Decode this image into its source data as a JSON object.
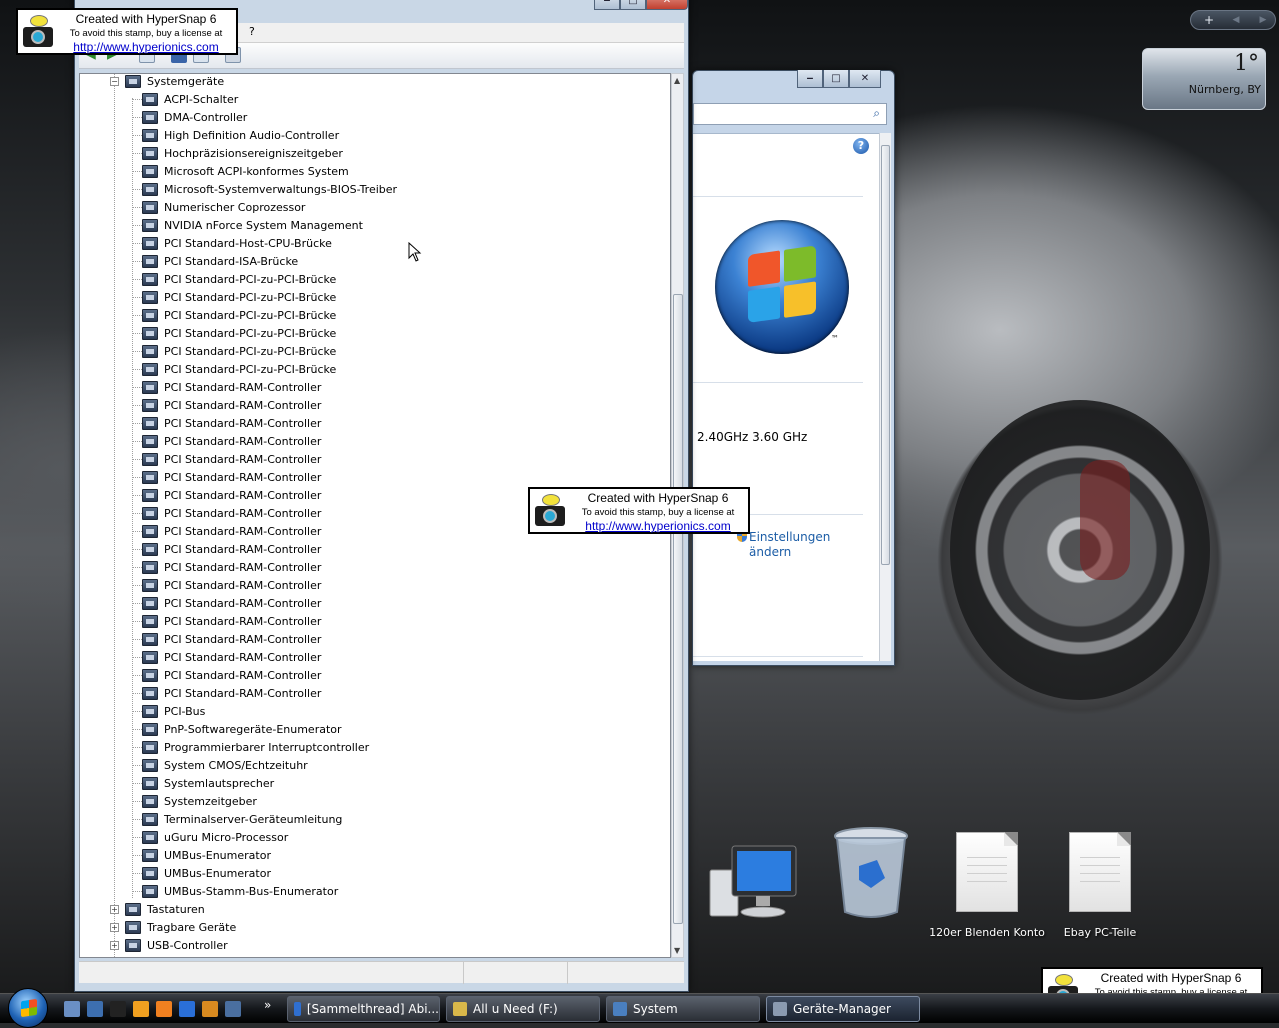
{
  "device_manager": {
    "title": "Geräte-Manager",
    "menu_partial": "?",
    "tree": {
      "category": "Systemgeräte",
      "children": [
        "ACPI-Schalter",
        "DMA-Controller",
        "High Definition Audio-Controller",
        "Hochpräzisionsereigniszeitgeber",
        "Microsoft ACPI-konformes System",
        "Microsoft-Systemverwaltungs-BIOS-Treiber",
        "Numerischer Coprozessor",
        "NVIDIA nForce System Management",
        "PCI Standard-Host-CPU-Brücke",
        "PCI Standard-ISA-Brücke",
        "PCI Standard-PCI-zu-PCI-Brücke",
        "PCI Standard-PCI-zu-PCI-Brücke",
        "PCI Standard-PCI-zu-PCI-Brücke",
        "PCI Standard-PCI-zu-PCI-Brücke",
        "PCI Standard-PCI-zu-PCI-Brücke",
        "PCI Standard-PCI-zu-PCI-Brücke",
        "PCI Standard-RAM-Controller",
        "PCI Standard-RAM-Controller",
        "PCI Standard-RAM-Controller",
        "PCI Standard-RAM-Controller",
        "PCI Standard-RAM-Controller",
        "PCI Standard-RAM-Controller",
        "PCI Standard-RAM-Controller",
        "PCI Standard-RAM-Controller",
        "PCI Standard-RAM-Controller",
        "PCI Standard-RAM-Controller",
        "PCI Standard-RAM-Controller",
        "PCI Standard-RAM-Controller",
        "PCI Standard-RAM-Controller",
        "PCI Standard-RAM-Controller",
        "PCI Standard-RAM-Controller",
        "PCI Standard-RAM-Controller",
        "PCI Standard-RAM-Controller",
        "PCI Standard-RAM-Controller",
        "PCI-Bus",
        "PnP-Softwaregeräte-Enumerator",
        "Programmierbarer Interruptcontroller",
        "System CMOS/Echtzeituhr",
        "Systemlautsprecher",
        "Systemzeitgeber",
        "Terminalserver-Geräteumleitung",
        "uGuru Micro-Processor",
        "UMBus-Enumerator",
        "UMBus-Enumerator",
        "UMBus-Stamm-Bus-Enumerator"
      ],
      "siblings_after": [
        "Tastaturen",
        "Tragbare Geräte",
        "USB-Controller"
      ],
      "collapsed_symbol": "−",
      "expand_symbol": "+"
    }
  },
  "system_window": {
    "help_symbol": "?",
    "search_icon": "search-icon",
    "cpu_text": "2.40GHz   3.60 GHz",
    "settings_link": [
      "Einstellungen",
      "ändern"
    ],
    "logo_tm": "™"
  },
  "weather_gadget": {
    "temperature": "1°",
    "city": "Nürnberg, BY"
  },
  "sidebar_controls": {
    "add": "+",
    "prev": "◀",
    "next": "▶"
  },
  "desktop_icons": [
    {
      "name": "computer-icon",
      "label": ""
    },
    {
      "name": "recycle-bin-icon",
      "label": ""
    },
    {
      "name": "document-icon",
      "label": "120er Blenden Konto"
    },
    {
      "name": "document-icon",
      "label": "Ebay PC-Teile"
    }
  ],
  "hypersnap_stamp": {
    "line1": "Created with HyperSnap 6",
    "line2": "To avoid this stamp, buy a license at",
    "url": "http://www.hyperionics.com"
  },
  "taskbar": {
    "chevron": "»",
    "tasks": [
      {
        "label": "[Sammelthread] Abi...",
        "icon_color": "#2f6fd0"
      },
      {
        "label": "All u Need (F:)",
        "icon_color": "#d9b84a"
      },
      {
        "label": "System",
        "icon_color": "#4a7fbf"
      },
      {
        "label": "Geräte-Manager",
        "icon_color": "#8a9ab0"
      }
    ],
    "quick_launch_colors": [
      "#6a8fc4",
      "#3d6fb0",
      "#222",
      "#f0a020",
      "#f08020",
      "#2a6fd8",
      "#d88a20",
      "#4a6fa0"
    ]
  },
  "colors": {
    "link": "#1c5da6",
    "stamp_url": "#0000cc",
    "taskbar_active": "#3d4a5e"
  }
}
